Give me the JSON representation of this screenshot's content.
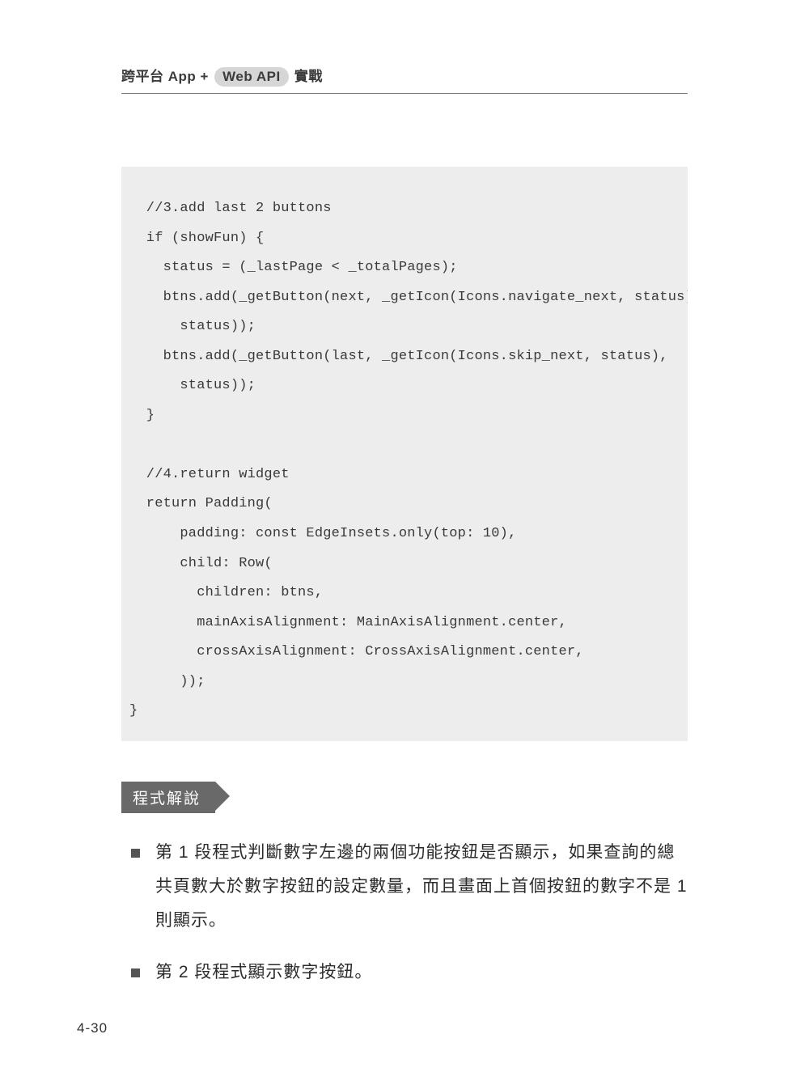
{
  "header": {
    "prefix": "跨平台",
    "app": "App +",
    "pill": "Web API",
    "suffix": "實戰"
  },
  "code": "  //3.add last 2 buttons\n  if (showFun) {\n    status = (_lastPage < _totalPages);\n    btns.add(_getButton(next, _getIcon(Icons.navigate_next, status),\n      status));\n    btns.add(_getButton(last, _getIcon(Icons.skip_next, status),\n      status));\n  }\n\n  //4.return widget\n  return Padding(\n      padding: const EdgeInsets.only(top: 10),\n      child: Row(\n        children: btns,\n        mainAxisAlignment: MainAxisAlignment.center,\n        crossAxisAlignment: CrossAxisAlignment.center,\n      ));\n}",
  "section_label": "程式解說",
  "explain": {
    "item1": "第 1 段程式判斷數字左邊的兩個功能按鈕是否顯示，如果查詢的總共頁數大於數字按鈕的設定數量，而且畫面上首個按鈕的數字不是 1 則顯示。",
    "item2": "第 2 段程式顯示數字按鈕。"
  },
  "page_number": "4-30"
}
